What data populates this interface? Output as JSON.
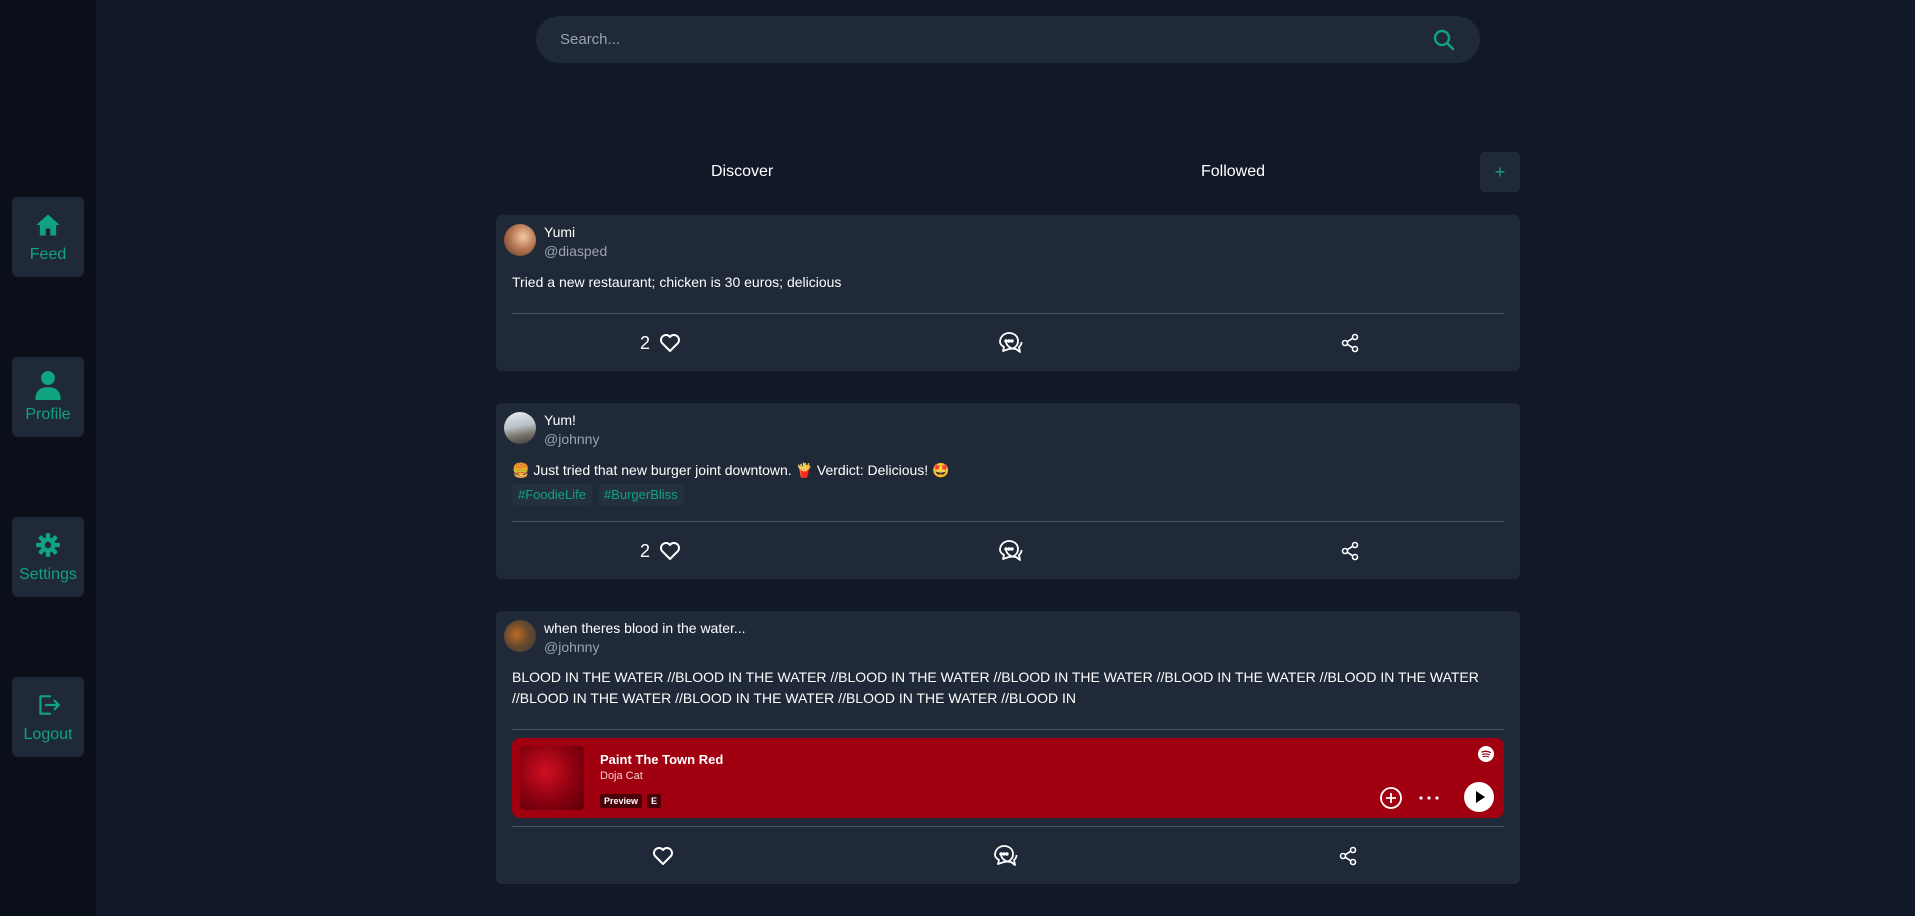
{
  "sidebar": {
    "items": [
      {
        "label": "Feed",
        "icon": "home-icon"
      },
      {
        "label": "Profile",
        "icon": "user-icon"
      },
      {
        "label": "Settings",
        "icon": "gear-icon"
      },
      {
        "label": "Logout",
        "icon": "logout-icon"
      }
    ]
  },
  "search": {
    "placeholder": "Search..."
  },
  "tabs": {
    "discover": "Discover",
    "followed": "Followed",
    "add_label": "+"
  },
  "posts": [
    {
      "name": "Yumi",
      "handle": "@diasped",
      "text": "Tried a new restaurant; chicken is 30 euros; delicious",
      "likes": "2"
    },
    {
      "name": "Yum!",
      "handle": "@johnny",
      "text": "🍔 Just tried that new burger joint downtown. 🍟 Verdict: Delicious! 🤩",
      "tags": [
        "#FoodieLife",
        "#BurgerBliss"
      ],
      "likes": "2"
    },
    {
      "name": "when theres blood in the water...",
      "handle": "@johnny",
      "text": "BLOOD IN THE WATER //BLOOD IN THE WATER //BLOOD IN THE WATER //BLOOD IN THE WATER //BLOOD IN THE WATER //BLOOD IN THE WATER //BLOOD IN THE WATER //BLOOD IN THE WATER //BLOOD IN THE WATER //BLOOD IN",
      "track": {
        "title": "Paint The Town Red",
        "artist": "Doja Cat",
        "badge_preview": "Preview",
        "badge_explicit": "E"
      }
    }
  ],
  "colors": {
    "accent": "#10a37f",
    "background": "#111827",
    "card": "#1f2937",
    "sidebar": "#0b0f1a",
    "spotify_card": "#a0000f"
  }
}
